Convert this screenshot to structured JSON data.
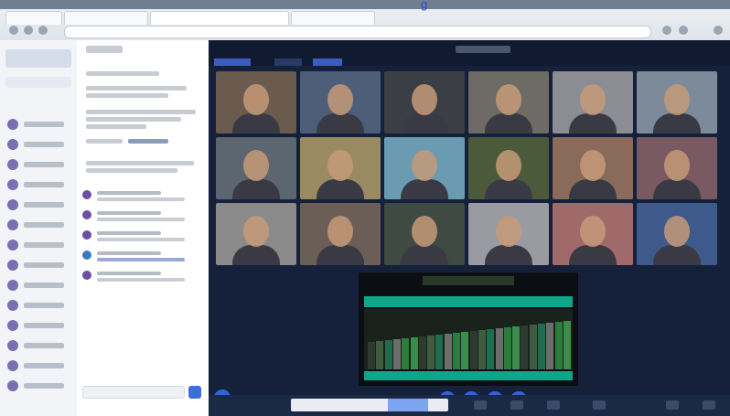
{
  "browser": {
    "link_text": "g",
    "tabs": [
      "",
      "",
      "",
      ""
    ],
    "address": ""
  },
  "meeting": {
    "tabs": [
      "",
      "",
      ""
    ],
    "title": "",
    "participants": 18,
    "tile_colors": [
      "#6b5a4e",
      "#4e5e78",
      "#3b3f45",
      "#6e6a66",
      "#8c8c94",
      "#7c8a9a",
      "#5c6670",
      "#9a8a62",
      "#6a9bb0",
      "#4a5a3a",
      "#8a6a5a",
      "#7a5a62",
      "#8a8a8a",
      "#6a5e56",
      "#3e4a42",
      "#9a9aa2",
      "#a06a6a",
      "#3e5a8a"
    ]
  },
  "taskbar": {
    "search_placeholder": ""
  },
  "icons": {
    "controls": [
      "camera-icon",
      "microphone-icon",
      "share-screen-icon",
      "participants-icon"
    ]
  },
  "chart_colors": {
    "accent": "#0fa58a",
    "bars": [
      "#2f3a2f",
      "#3f5c3f",
      "#1e6d4e",
      "#6d6d6d",
      "#2a7d3a",
      "#3a8d4a"
    ]
  }
}
